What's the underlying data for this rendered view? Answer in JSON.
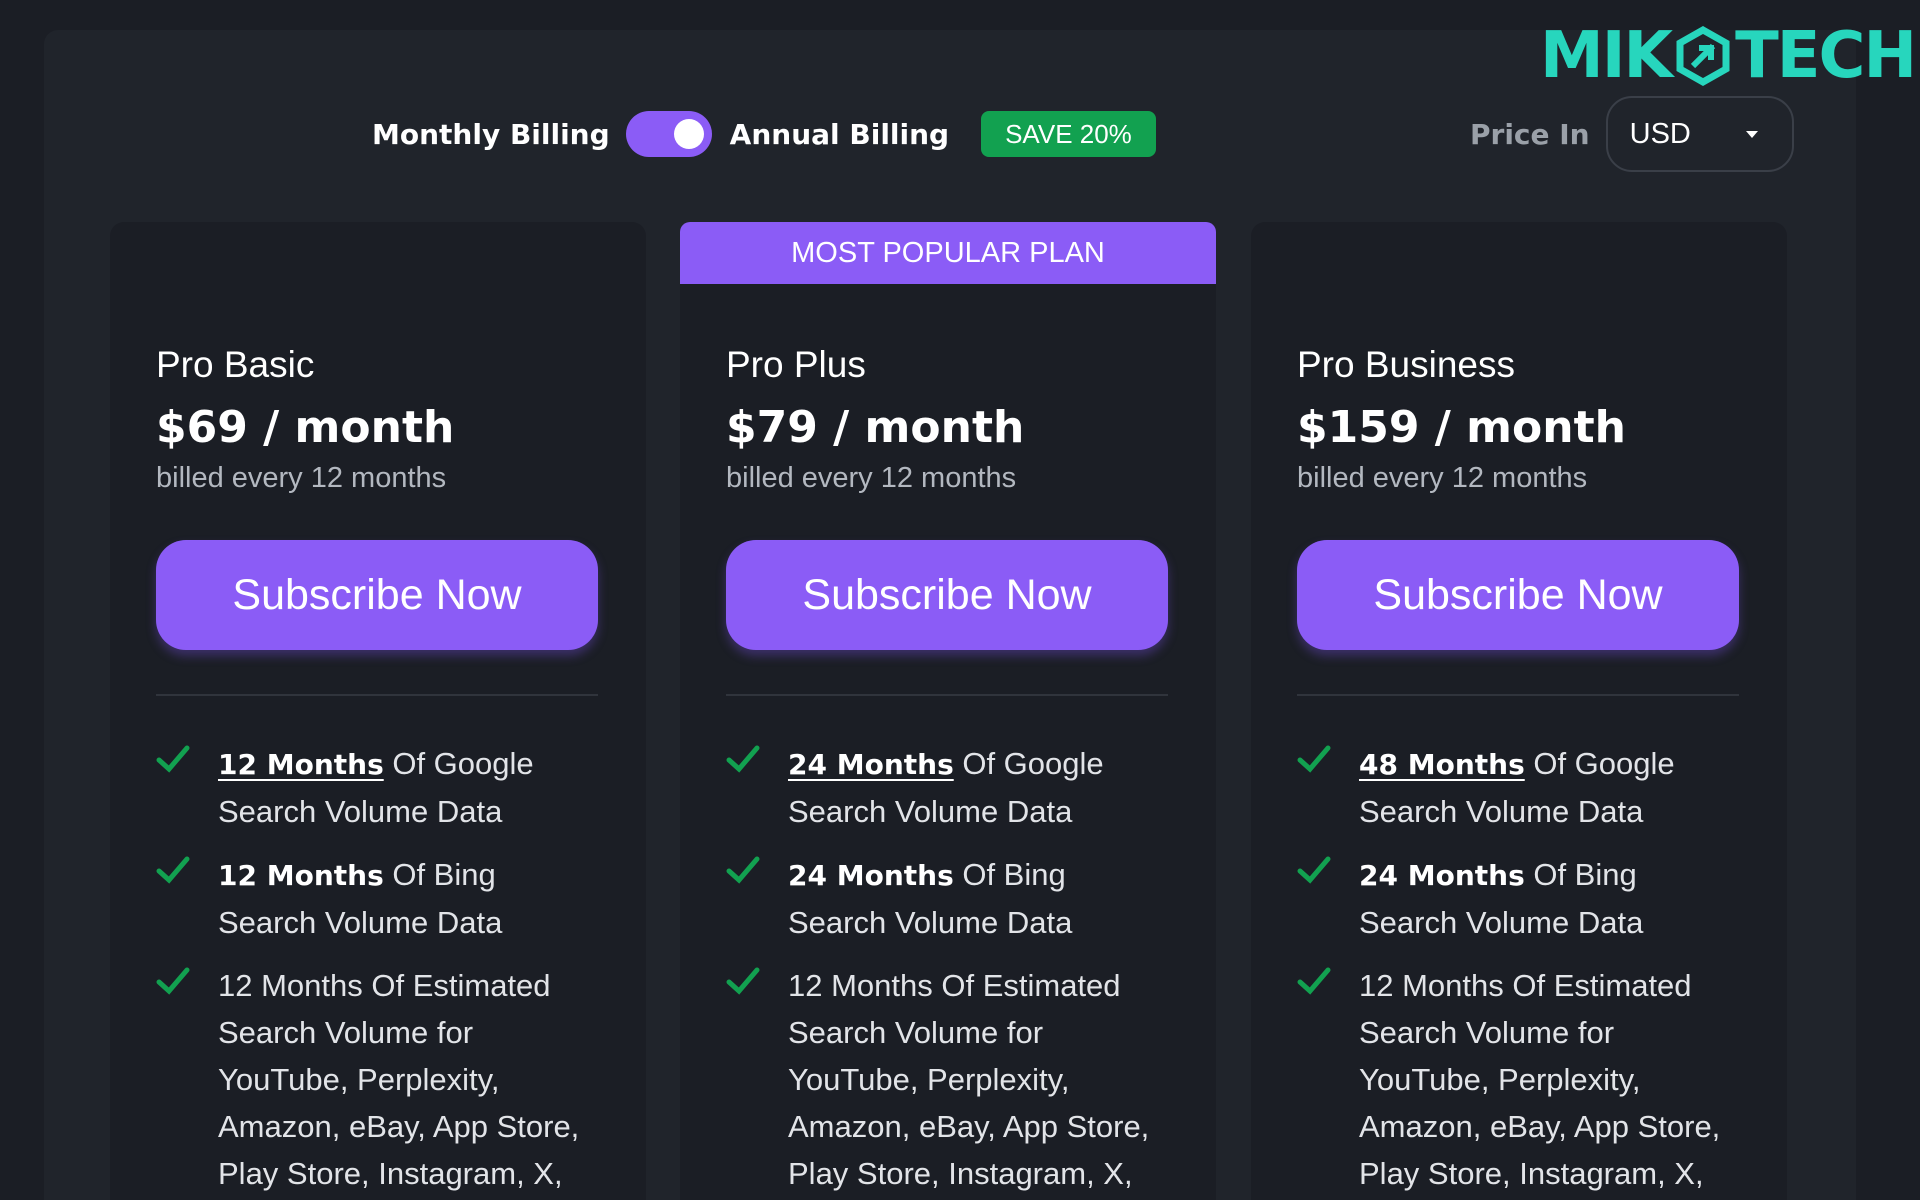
{
  "brand": {
    "logo_left": "MIK",
    "logo_right": "TECH",
    "color": "#27d6bd"
  },
  "billing": {
    "monthly_label": "Monthly Billing",
    "annual_label": "Annual Billing",
    "toggle_state": "annual",
    "save_badge": "SAVE 20%"
  },
  "currency": {
    "label": "Price In",
    "selected": "USD"
  },
  "colors": {
    "accent": "#8b5cf6",
    "check": "#12a150",
    "badge": "#12a150"
  },
  "plans": [
    {
      "name": "Pro Basic",
      "price": "$69 / month",
      "billed": "billed every 12 months",
      "cta": "Subscribe Now",
      "popular": false,
      "features": [
        {
          "lead": "12 Months",
          "rest": " Of Google Search Volume Data"
        },
        {
          "lead": "12 Months",
          "rest": " Of Bing Search Volume Data"
        },
        {
          "lead": "",
          "rest": "12 Months Of Estimated Search Volume for YouTube, Perplexity, Amazon, eBay, App Store, Play Store, Instagram, X,"
        }
      ]
    },
    {
      "name": "Pro Plus",
      "price": "$79 / month",
      "billed": "billed every 12 months",
      "cta": "Subscribe Now",
      "popular": true,
      "banner": "MOST POPULAR PLAN",
      "features": [
        {
          "lead": "24 Months",
          "rest": " Of Google Search Volume Data"
        },
        {
          "lead": "24 Months",
          "rest": " Of Bing Search Volume Data"
        },
        {
          "lead": "",
          "rest": "12 Months Of Estimated Search Volume for YouTube, Perplexity, Amazon, eBay, App Store, Play Store, Instagram, X,"
        }
      ]
    },
    {
      "name": "Pro Business",
      "price": "$159 / month",
      "billed": "billed every 12 months",
      "cta": "Subscribe Now",
      "popular": false,
      "features": [
        {
          "lead": "48 Months",
          "rest": " Of Google Search Volume Data"
        },
        {
          "lead": "24 Months",
          "rest": " Of Bing Search Volume Data"
        },
        {
          "lead": "",
          "rest": "12 Months Of Estimated Search Volume for YouTube, Perplexity, Amazon, eBay, App Store, Play Store, Instagram, X,"
        }
      ]
    }
  ]
}
